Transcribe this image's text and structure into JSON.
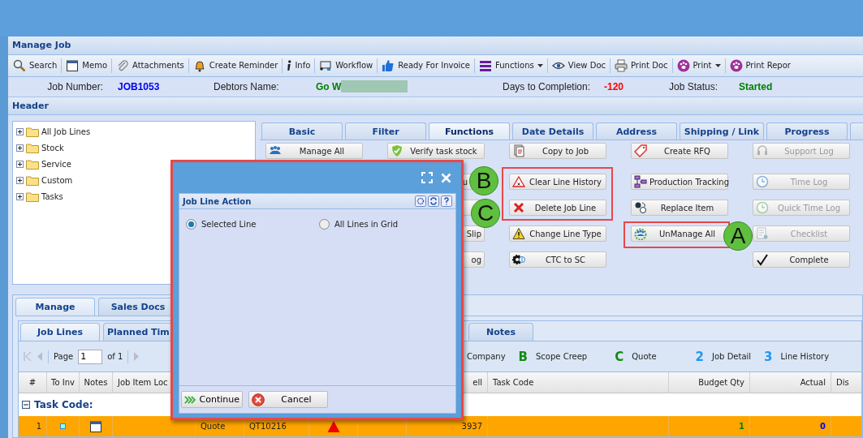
{
  "window": {
    "title": "Manage Job"
  },
  "toolbar": [
    {
      "label": "Search"
    },
    {
      "label": "Memo"
    },
    {
      "label": "Attachments"
    },
    {
      "label": "Create Reminder"
    },
    {
      "label": "Info"
    },
    {
      "label": "Workflow"
    },
    {
      "label": "Ready For Invoice"
    },
    {
      "label": "Functions",
      "dropdown": true
    },
    {
      "label": "View Doc"
    },
    {
      "label": "Print Doc"
    },
    {
      "label": "Print",
      "dropdown": true
    },
    {
      "label": "Print Repor"
    }
  ],
  "job_info": [
    {
      "label": "Job Number:",
      "value": "JOB1053",
      "color": "#0000ee",
      "redacted": false
    },
    {
      "label": "Debtors Name:",
      "value": "Go W",
      "color": "#008000",
      "redacted": true
    },
    {
      "label": "Days to Completion:",
      "value": "-120",
      "color": "#ff0000",
      "redacted": false
    },
    {
      "label": "Job Status:",
      "value": "Started",
      "color": "#008000",
      "redacted": false
    }
  ],
  "header": {
    "title": "Header",
    "tree": [
      {
        "label": "All Job Lines",
        "expanded": false
      },
      {
        "label": "Stock",
        "expanded": false
      },
      {
        "label": "Service",
        "expanded": false
      },
      {
        "label": "Custom",
        "expanded": false
      },
      {
        "label": "Tasks",
        "expanded": false
      }
    ],
    "tabs": [
      {
        "label": "Basic",
        "selected": false
      },
      {
        "label": "Filter",
        "selected": false
      },
      {
        "label": "Functions",
        "selected": true
      },
      {
        "label": "Date Details",
        "selected": false
      },
      {
        "label": "Address",
        "selected": false
      },
      {
        "label": "Shipping / Link",
        "selected": false
      },
      {
        "label": "Progress",
        "selected": false
      },
      {
        "selected": false
      }
    ],
    "function_columns": [
      [
        {
          "label": "Manage All",
          "disabled": false
        }
      ],
      [
        {
          "label": "Verify task stock",
          "disabled": false
        },
        {
          "label": "u"
        },
        {},
        {
          "label": "Slip",
          "disabled": false
        },
        {
          "label": "og",
          "disabled": false
        }
      ],
      [
        {
          "label": "Copy to Job",
          "disabled": false
        },
        {
          "label": "Clear Line History",
          "disabled": false
        },
        {
          "label": "Delete Job Line",
          "disabled": false
        },
        {
          "label": "Change Line Type",
          "disabled": false
        },
        {
          "label": "CTC to SC",
          "disabled": false
        }
      ],
      [
        {
          "label": "Create RFQ",
          "disabled": false
        },
        {
          "label": "Production Tracking",
          "disabled": false
        },
        {
          "label": "Replace Item",
          "disabled": false
        },
        {
          "label": "UnManage All",
          "disabled": false
        }
      ],
      [
        {
          "label": "Support Log",
          "disabled": true
        },
        {
          "label": "Time Log",
          "disabled": true
        },
        {
          "label": "Quick Time Log",
          "disabled": true
        },
        {
          "label": "Checklist",
          "disabled": true
        },
        {
          "label": "Complete",
          "disabled": false
        }
      ]
    ]
  },
  "callouts": [
    {
      "letter": "B"
    },
    {
      "letter": "C"
    },
    {
      "letter": "A"
    }
  ],
  "bottom": {
    "tabs": [
      {
        "label": "Manage",
        "selected": true
      },
      {
        "label": "Sales Docs",
        "selected": false
      }
    ],
    "subtabs": [
      {
        "label": "Job Lines",
        "selected": true
      },
      {
        "label": "Planned Tim",
        "selected": false
      },
      {
        "label": "Notes",
        "selected": false
      }
    ],
    "pager": {
      "page_label": "Page",
      "page": "1",
      "of": "of 1"
    },
    "legend": [
      {
        "label": "Company"
      },
      {
        "mark": "B",
        "label": "Scope Creep",
        "color": "#138a13"
      },
      {
        "mark": "C",
        "label": "Quote",
        "color": "#138a13"
      },
      {
        "mark": "2",
        "label": "Job Detail",
        "color": "#2196f3"
      },
      {
        "mark": "3",
        "label": "Line History",
        "color": "#2196f3"
      }
    ],
    "columns": [
      {
        "label": "#"
      },
      {
        "label": "To Inv"
      },
      {
        "label": "Notes"
      },
      {
        "label": "Job Item Loc"
      },
      {},
      {},
      {},
      {},
      {
        "label": "ell"
      },
      {
        "label": "Task Code"
      },
      {
        "label": "Budget Qty"
      },
      {
        "label": "Actual"
      },
      {
        "label": "Dis"
      }
    ],
    "group": {
      "label": "Task Code:",
      "expanded": true
    },
    "rows": [
      {
        "cells": [
          {
            "kind": "number",
            "text": "1"
          },
          {
            "kind": "dot"
          },
          {
            "kind": "notes"
          },
          {
            "kind": "empty"
          },
          {
            "kind": "text",
            "text": "Quote"
          },
          {
            "kind": "text",
            "text": "QT10216"
          },
          {
            "kind": "warning"
          },
          {
            "kind": "empty"
          },
          {
            "kind": "number",
            "text": "3937"
          },
          {
            "kind": "empty"
          },
          {
            "kind": "number",
            "text": "1",
            "color": "#008000"
          },
          {
            "kind": "number",
            "text": "0",
            "color": "#0000ff"
          },
          {
            "kind": "empty"
          }
        ]
      }
    ]
  },
  "dialog": {
    "panel_title": "Job Line Action",
    "options": [
      {
        "label": "Selected Line",
        "selected": true
      },
      {
        "label": "All Lines in Grid",
        "selected": false
      }
    ],
    "buttons": [
      {
        "label": "Continue",
        "kind": "continue"
      },
      {
        "label": "Cancel",
        "kind": "cancel"
      }
    ]
  }
}
